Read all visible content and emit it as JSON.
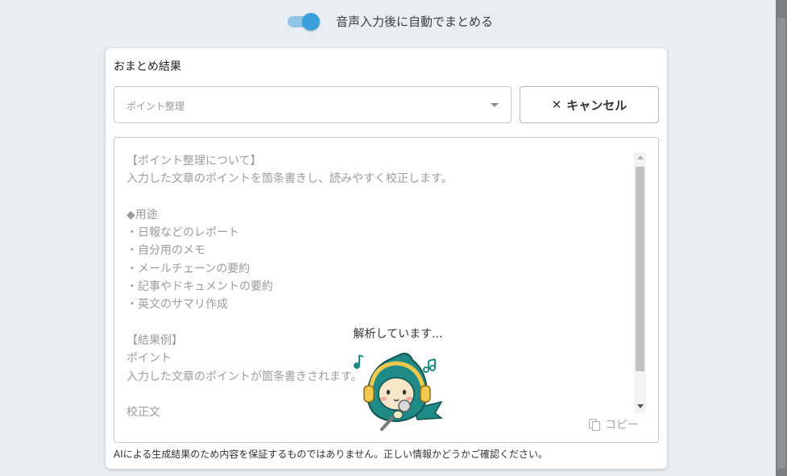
{
  "toggle": {
    "label": "音声入力後に自動でまとめる",
    "on": true
  },
  "card": {
    "title": "おまとめ結果",
    "select": {
      "placeholder": "ポイント整理"
    },
    "cancel": {
      "icon": "✕",
      "label": "キャンセル"
    },
    "result": {
      "lines": [
        "【ポイント整理について】",
        "入力した文章のポイントを箇条書きし、読みやすく校正します。",
        "",
        "◆用途",
        "・日報などのレポート",
        "・自分用のメモ",
        "・メールチェーンの要約",
        "・記事やドキュメントの要約",
        "・英文のサマリ作成",
        "",
        "【結果例】",
        "ポイント",
        "入力した文章のポイントが箇条書きされます。",
        "",
        "校正文"
      ]
    },
    "loading": {
      "text": "解析しています..."
    },
    "copy": {
      "label": "コピー"
    },
    "disclaimer": "AIによる生成結果のため内容を保証するものではありません。正しい情報かどうかご確認ください。"
  },
  "colors": {
    "accent": "#3aa0dc",
    "mascot_teal": "#1f8a86",
    "mascot_yellow": "#f2c94c"
  },
  "icons": {
    "dropdown": "chevron-down-icon",
    "cancel": "close-icon",
    "copy": "copy-icon",
    "mascot": "mascot-headphones-icon"
  }
}
